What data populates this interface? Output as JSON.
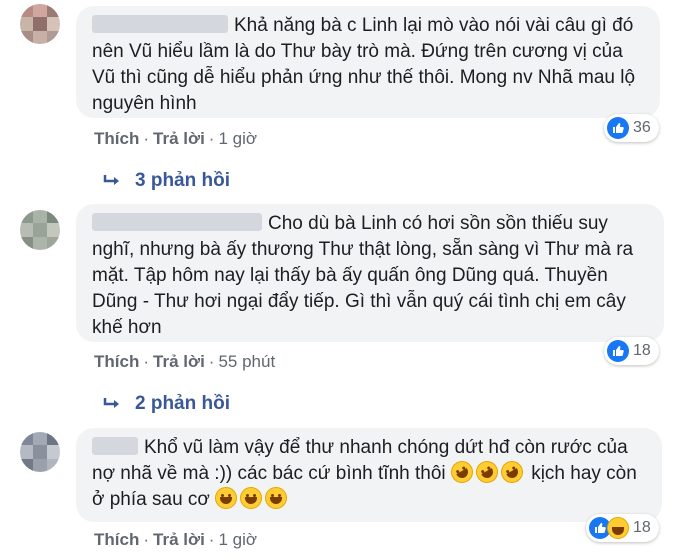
{
  "colors": {
    "bubble": "#f2f3f5",
    "link": "#385898",
    "meta": "#606770",
    "like": "#1877f2"
  },
  "comments": [
    {
      "text": "Khả năng bà c Linh lại mò vào nói vài câu gì đó nên Vũ hiểu lầm là do Thư bày trò mà. Đứng trên cương vị của Vũ thì cũng dễ hiểu phản ứng như thế thôi. Mong nv Nhã mau lộ nguyên hình",
      "like_label": "Thích",
      "reply_label": "Trả lời",
      "time": "1 giờ",
      "reaction_count": "36",
      "replies": "3 phản hồi"
    },
    {
      "text": "Cho dù bà Linh có hơi sồn sồn thiếu suy nghĩ, nhưng bà ấy thương Thư thật lòng, sẵn sàng vì Thư mà ra mặt. Tập hôm nay lại thấy bà ấy quấn ông Dũng quá. Thuyền Dũng - Thư hơi ngại đẩy tiếp. Gì thì vẫn quý cái tình chị em cây khế hơn",
      "like_label": "Thích",
      "reply_label": "Trả lời",
      "time": "55 phút",
      "reaction_count": "18",
      "replies": "2 phản hồi"
    },
    {
      "text_a": "Khổ vũ làm vậy để thư nhanh chóng dứt hđ còn rước của nợ nhã về mà :)) các bác cứ bình tĩnh thôi",
      "text_b": "kịch hay còn ở phía sau cơ",
      "like_label": "Thích",
      "reply_label": "Trả lời",
      "time": "1 giờ",
      "reaction_count": "18"
    }
  ],
  "separator": "·"
}
